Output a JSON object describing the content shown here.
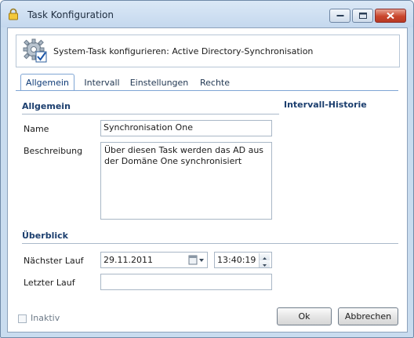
{
  "window": {
    "title": "Task Konfiguration"
  },
  "header": {
    "text": "System-Task konfigurieren: Active Directory-Synchronisation"
  },
  "tabs": [
    {
      "label": "Allgemein",
      "active": true
    },
    {
      "label": "Intervall",
      "active": false
    },
    {
      "label": "Einstellungen",
      "active": false
    },
    {
      "label": "Rechte",
      "active": false
    }
  ],
  "general": {
    "section_title": "Allgemein",
    "name_label": "Name",
    "name_value": "Synchronisation One",
    "description_label": "Beschreibung",
    "description_value": "Über diesen Task werden das AD aus der Domäne One synchronisiert"
  },
  "history": {
    "section_title": "Intervall-Historie"
  },
  "overview": {
    "section_title": "Überblick",
    "next_run_label": "Nächster Lauf",
    "next_run_date": "29.11.2011",
    "next_run_time": "13:40:19",
    "last_run_label": "Letzter Lauf",
    "last_run_value": ""
  },
  "footer": {
    "inactive_label": "Inaktiv",
    "inactive_checked": false,
    "ok_label": "Ok",
    "cancel_label": "Abbrechen"
  },
  "colors": {
    "accent": "#1b3e6e",
    "title_bar": "#c4d8ee",
    "close_button": "#c9462c"
  }
}
